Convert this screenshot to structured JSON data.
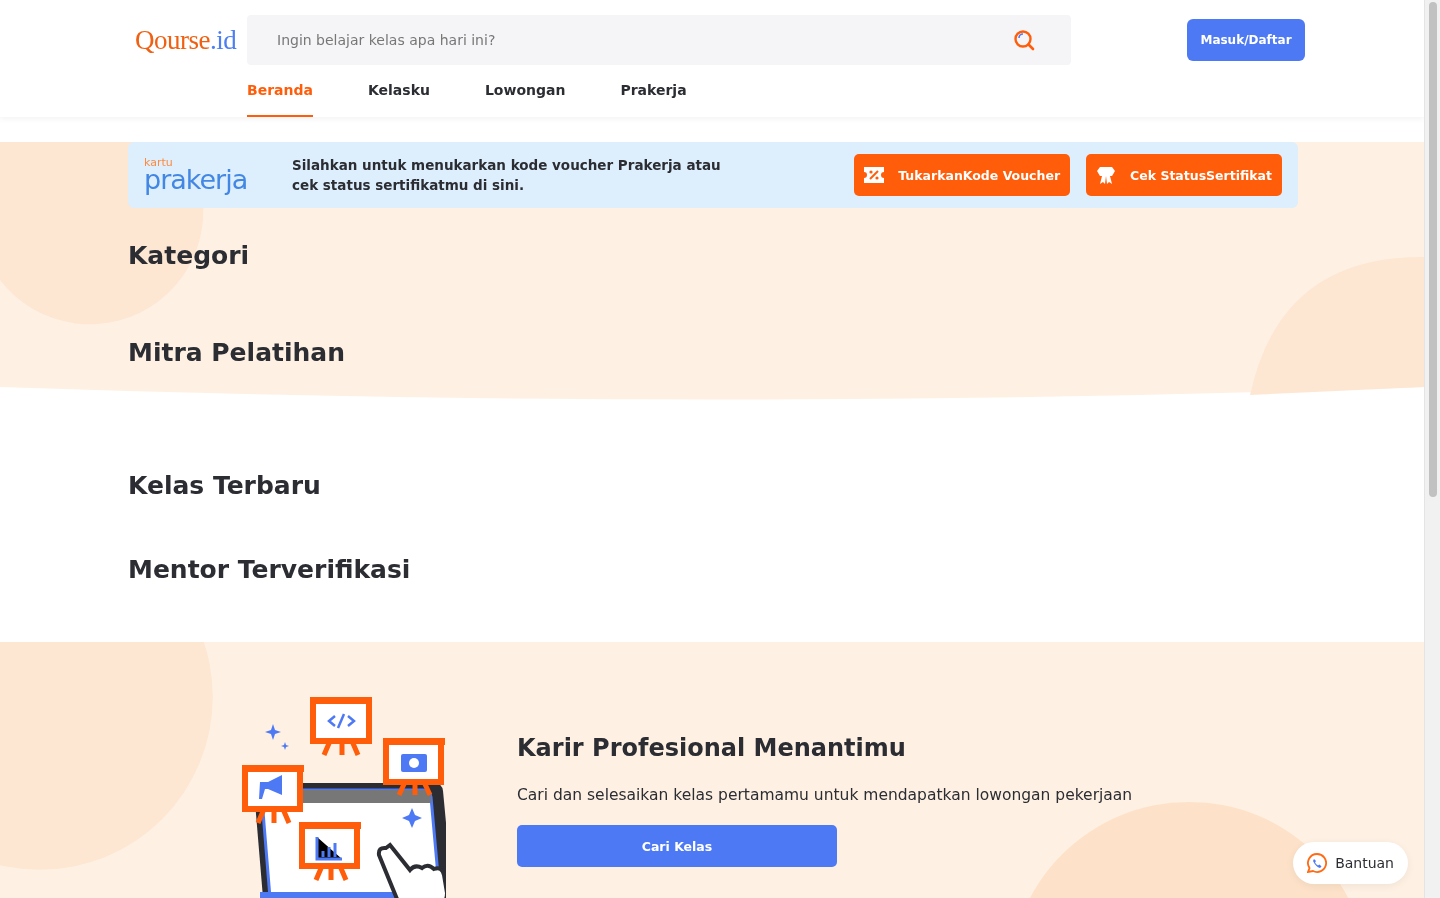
{
  "header": {
    "logo": {
      "name": "Qourse",
      "suffix": ".id"
    },
    "search": {
      "placeholder": "Ingin belajar kelas apa hari ini?"
    },
    "login_button": "Masuk/Daftar"
  },
  "nav": [
    {
      "label": "Beranda",
      "selected": true
    },
    {
      "label": "Kelasku",
      "selected": false
    },
    {
      "label": "Lowongan",
      "selected": false
    },
    {
      "label": "Prakerja",
      "selected": false
    }
  ],
  "prakerja_banner": {
    "logo": {
      "top": "kartu",
      "main": "prakerja"
    },
    "message": "Silahkan untuk menukarkan kode voucher Prakerja atau cek status sertifikatmu di sini.",
    "buttons": [
      {
        "kind": "voucher",
        "label": "TukarkanKode Voucher"
      },
      {
        "kind": "certificate",
        "label": "Cek StatusSertifikat"
      }
    ]
  },
  "sections": [
    {
      "title": "Kategori"
    },
    {
      "title": "Mitra Pelatihan"
    },
    {
      "title": "Kelas Terbaru"
    },
    {
      "title": "Mentor Terverifikasi"
    }
  ],
  "cta": {
    "title": "Karir Profesional Menantimu",
    "text": "Cari dan selesaikan kelas pertamamu untuk mendapatkan lowongan pekerjaan",
    "button": "Cari Kelas"
  },
  "help_button": "Bantuan"
}
